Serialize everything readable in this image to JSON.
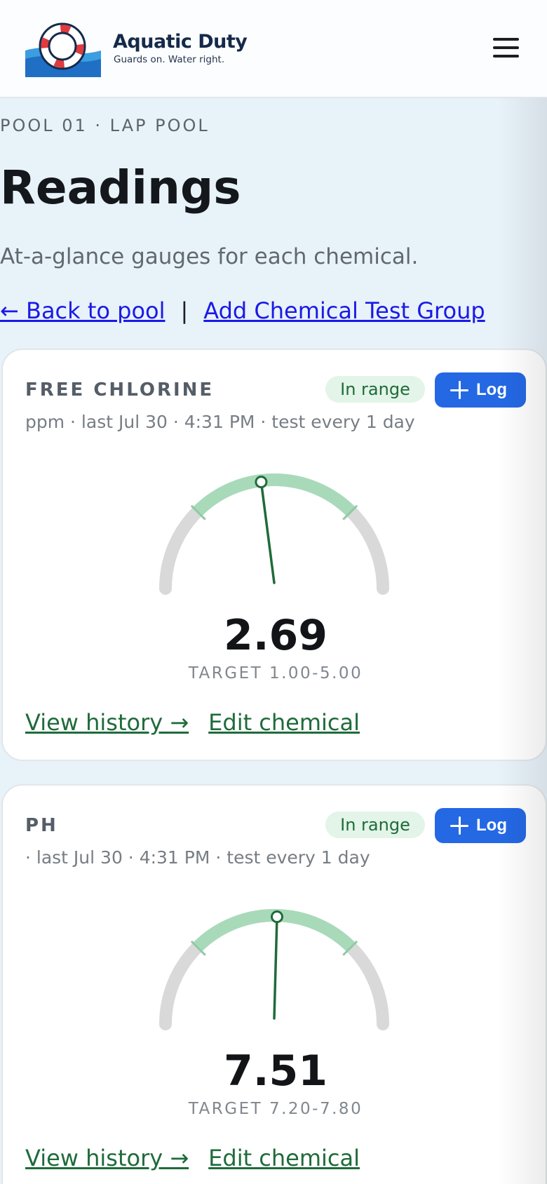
{
  "header": {
    "brand_name": "Aquatic Duty",
    "brand_tagline": "Guards on. Water right.",
    "menu_icon": "hamburger-icon"
  },
  "page": {
    "eyebrow": "POOL 01 · LAP POOL",
    "title": "Readings",
    "subtitle": "At-a-glance gauges for each chemical.",
    "back_link": "← Back to pool",
    "separator": "|",
    "add_group_link": "Add Chemical Test Group"
  },
  "chemicals": [
    {
      "name": "FREE CHLORINE",
      "status": "In range",
      "log_label": "Log",
      "meta": "ppm · last Jul 30 · 4:31 PM · test every 1 day",
      "value_text": "2.69",
      "target_text": "TARGET 1.00-5.00",
      "history_link": "View history →",
      "edit_link": "Edit chemical",
      "gauge": {
        "value": 2.69,
        "target_min": 1.0,
        "target_max": 5.0,
        "scale_min": -1.0,
        "scale_max": 7.0
      }
    },
    {
      "name": "PH",
      "status": "In range",
      "log_label": "Log",
      "meta": "· last Jul 30 · 4:31 PM · test every 1 day",
      "value_text": "7.51",
      "target_text": "TARGET 7.20-7.80",
      "history_link": "View history →",
      "edit_link": "Edit chemical",
      "gauge": {
        "value": 7.51,
        "target_min": 7.2,
        "target_max": 7.8,
        "scale_min": 6.9,
        "scale_max": 8.1
      }
    }
  ],
  "colors": {
    "accent_blue": "#2468e4",
    "in_range_green": "#1f6b3a",
    "range_band": "#a8dab9",
    "track_gray": "#d9d9d9",
    "lifebuoy_red": "#e0393e",
    "water_blue": "#1f6fc4"
  }
}
